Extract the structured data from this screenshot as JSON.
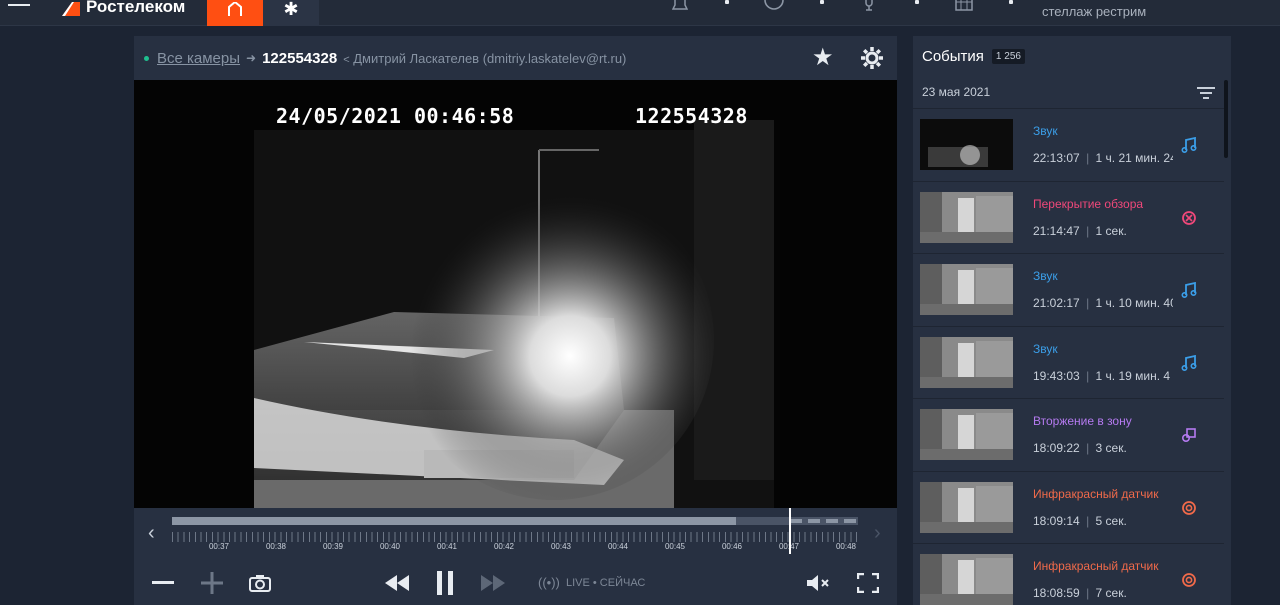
{
  "topbar": {
    "brand": "Ростелеком",
    "account_label": "стеллаж рестрим",
    "accent_color": "#ff4f12",
    "icons": [
      "menu-icon",
      "home-icon",
      "snowflake-icon",
      "bell-icon",
      "user-icon",
      "microphone-icon",
      "calendar-icon"
    ]
  },
  "player": {
    "breadcrumb_root": "Все камеры",
    "camera_id": "122554328",
    "owner": "Дмитрий Ласкателев (dmitriy.laskatelev@rt.ru)",
    "osd_datetime": "24/05/2021 00:46:58",
    "osd_camera": "122554328",
    "timeline": {
      "labels": [
        "00:37",
        "00:38",
        "00:39",
        "00:40",
        "00:41",
        "00:42",
        "00:43",
        "00:44",
        "00:45",
        "00:46",
        "00:47",
        "00:48"
      ],
      "current": "00:46:58"
    },
    "live_label": "LIVE • СЕЙЧАС"
  },
  "events": {
    "title": "События",
    "count": "1 256",
    "date": "23 мая 2021",
    "items": [
      {
        "title": "Звук",
        "time": "22:13:07",
        "duration": "1 ч. 21 мин. 24...",
        "color": "#3b9ee8",
        "icon": "music-note-icon",
        "thumb": "dark"
      },
      {
        "title": "Перекрытие обзора",
        "time": "21:14:47",
        "duration": "1 сек.",
        "color": "#f0487a",
        "icon": "blocked-view-icon",
        "thumb": "room"
      },
      {
        "title": "Звук",
        "time": "21:02:17",
        "duration": "1 ч. 10 мин. 40...",
        "color": "#3b9ee8",
        "icon": "music-note-icon",
        "thumb": "room"
      },
      {
        "title": "Звук",
        "time": "19:43:03",
        "duration": "1 ч. 19 мин. 4 ...",
        "color": "#3b9ee8",
        "icon": "music-note-icon",
        "thumb": "room"
      },
      {
        "title": "Вторжение в зону",
        "time": "18:09:22",
        "duration": "3 сек.",
        "color": "#b57af0",
        "icon": "zone-intrusion-icon",
        "thumb": "room"
      },
      {
        "title": "Инфракрасный датчик",
        "time": "18:09:14",
        "duration": "5 сек.",
        "color": "#f06a4a",
        "icon": "infrared-sensor-icon",
        "thumb": "room"
      },
      {
        "title": "Инфракрасный датчик",
        "time": "18:08:59",
        "duration": "7 сек.",
        "color": "#f06a4a",
        "icon": "infrared-sensor-icon",
        "thumb": "room"
      }
    ]
  }
}
